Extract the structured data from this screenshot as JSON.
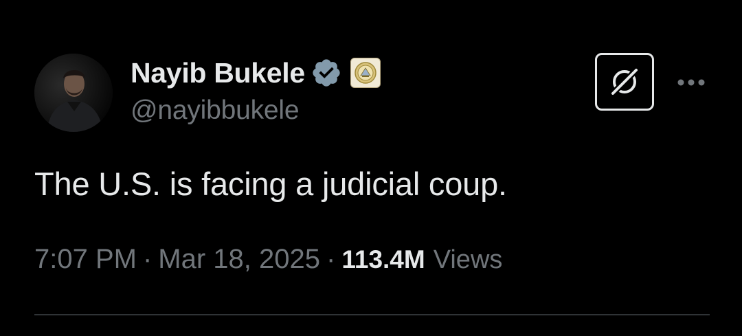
{
  "author": {
    "display_name": "Nayib Bukele",
    "handle": "@nayibbukele",
    "verified_badge_icon": "verified-check-icon",
    "verified_color": "#829aab",
    "affiliate_badge_icon": "el-salvador-seal-icon"
  },
  "actions": {
    "grok_icon": "grok-icon",
    "more_icon": "more-dots-icon"
  },
  "tweet": {
    "text": "The U.S. is facing a judicial coup."
  },
  "meta": {
    "time": "7:07 PM",
    "separator": "·",
    "date": "Mar 18, 2025",
    "views_count": "113.4M",
    "views_label": "Views"
  },
  "colors": {
    "background": "#000000",
    "primary_text": "#e7e9ea",
    "secondary_text": "#71767b",
    "divider": "#2f3336"
  }
}
